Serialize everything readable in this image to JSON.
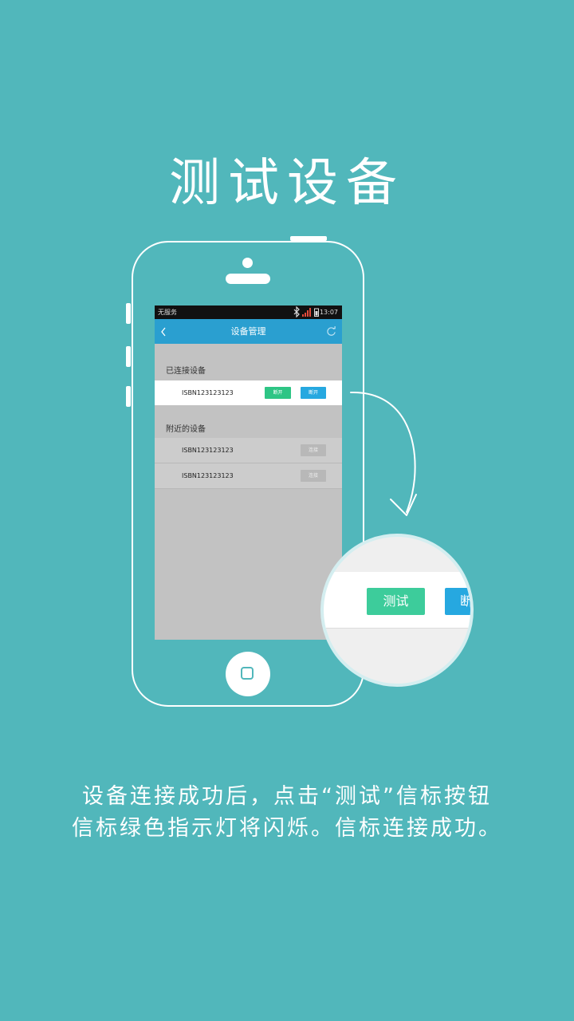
{
  "title": "测试设备",
  "phone_screen": {
    "status_bar": {
      "carrier": "无服务",
      "time": "13:07"
    },
    "header": {
      "title": "设备管理",
      "back_icon": "chevron-left-icon",
      "refresh_icon": "refresh-icon"
    },
    "connected_section": {
      "label": "已连接设备",
      "devices": [
        {
          "name": "ISBN123123123",
          "test_label": "断开",
          "disconnect_label": "断开"
        }
      ]
    },
    "nearby_section": {
      "label": "附近的设备",
      "devices": [
        {
          "name": "ISBN123123123",
          "connect_label": "连接"
        },
        {
          "name": "ISBN123123123",
          "connect_label": "连接"
        }
      ]
    }
  },
  "magnifier": {
    "test_button_label": "测试",
    "disconnect_button_label": "断开"
  },
  "caption": {
    "line1": "设备连接成功后，点击“测试”信标按钮",
    "line2": "信标绿色指示灯将闪烁。信标连接成功。"
  },
  "colors": {
    "background": "#51b7bb",
    "header": "#2a9fd0",
    "green_button": "#3dcc9b",
    "blue_button": "#26a8e0"
  }
}
